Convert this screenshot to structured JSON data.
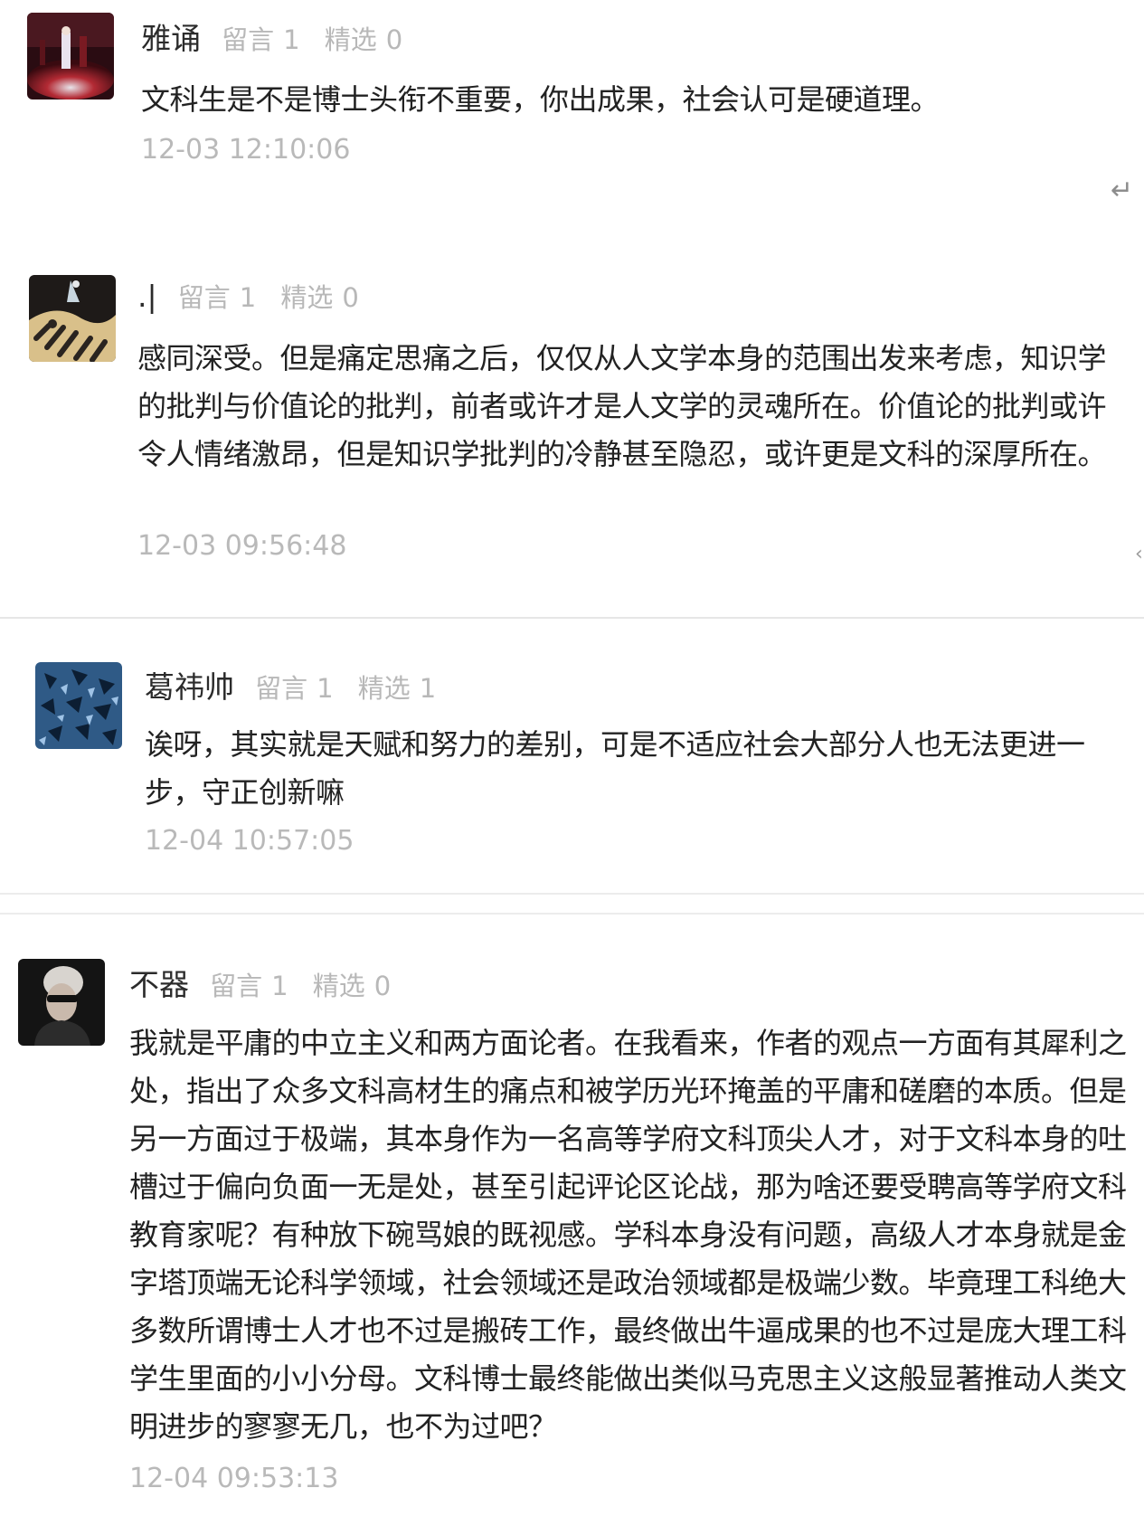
{
  "comments": [
    {
      "name": "雅诵",
      "liuyan_label": "留言",
      "liuyan_count": "1",
      "jingxuan_label": "精选",
      "jingxuan_count": "0",
      "text": "文科生是不是博士头衔不重要，你出成果，社会认可是硬道理。",
      "time": "12-03 12:10:06"
    },
    {
      "name": ".|",
      "liuyan_label": "留言",
      "liuyan_count": "1",
      "jingxuan_label": "精选",
      "jingxuan_count": "0",
      "text": "感同深受。但是痛定思痛之后，仅仅从人文学本身的范围出发来考虑，知识学的批判与价值论的批判，前者或许才是人文学的灵魂所在。价值论的批判或许令人情绪激昂，但是知识学批判的冷静甚至隐忍，或许更是文科的深厚所在。",
      "time": "12-03 09:56:48"
    },
    {
      "name": "葛祎帅",
      "liuyan_label": "留言",
      "liuyan_count": "1",
      "jingxuan_label": "精选",
      "jingxuan_count": "1",
      "text": "诶呀，其实就是天赋和努力的差别，可是不适应社会大部分人也无法更进一步，守正创新嘛",
      "time": "12-04 10:57:05"
    },
    {
      "name": "不器",
      "liuyan_label": "留言",
      "liuyan_count": "1",
      "jingxuan_label": "精选",
      "jingxuan_count": "0",
      "text": "我就是平庸的中立主义和两方面论者。在我看来，作者的观点一方面有其犀利之处，指出了众多文科高材生的痛点和被学历光环掩盖的平庸和磋磨的本质。但是另一方面过于极端，其本身作为一名高等学府文科顶尖人才，对于文科本身的吐槽过于偏向负面一无是处，甚至引起评论区论战，那为啥还要受聘高等学府文科教育家呢？有种放下碗骂娘的既视感。学科本身没有问题，高级人才本身就是金字塔顶端无论科学领域，社会领域还是政治领域都是极端少数。毕竟理工科绝大多数所谓博士人才也不过是搬砖工作，最终做出牛逼成果的也不过是庞大理工科学生里面的小小分母。文科博士最终能做出类似马克思主义这般显著推动人类文明进步的寥寥无几，也不为过吧？",
      "time": "12-04 09:53:13"
    }
  ],
  "icons": {
    "reply": "reply-arrow-icon",
    "edge": "chevron-left-icon"
  }
}
